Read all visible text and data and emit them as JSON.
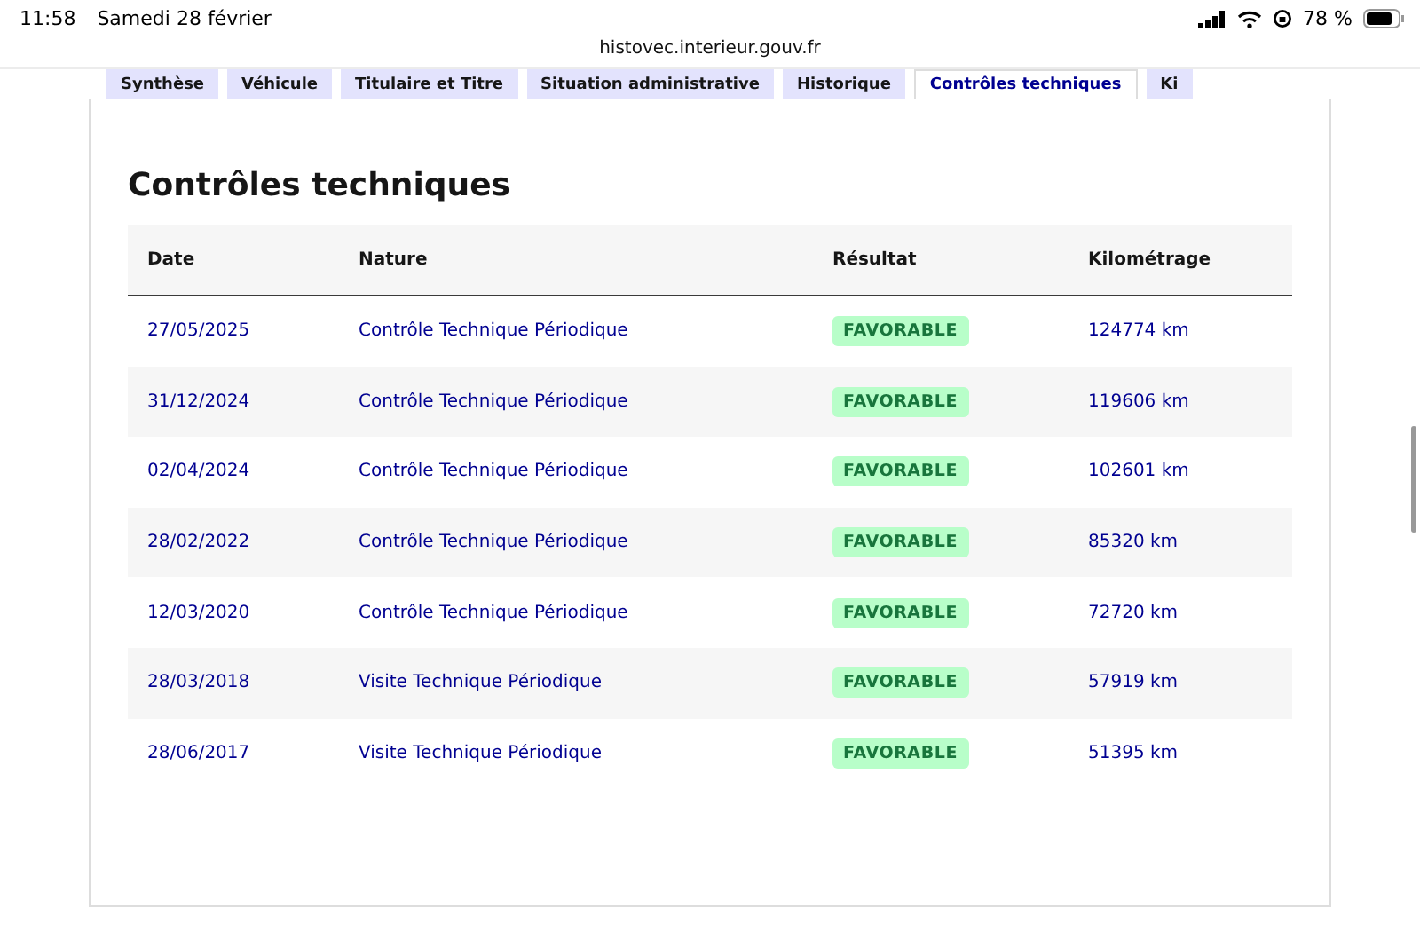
{
  "status_bar": {
    "time": "11:58",
    "date": "Samedi 28 février",
    "battery": "78 %"
  },
  "address_bar": {
    "url": "histovec.interieur.gouv.fr"
  },
  "tabs": [
    {
      "label": "Synthèse",
      "selected": false
    },
    {
      "label": "Véhicule",
      "selected": false
    },
    {
      "label": "Titulaire et Titre",
      "selected": false
    },
    {
      "label": "Situation administrative",
      "selected": false
    },
    {
      "label": "Historique",
      "selected": false
    },
    {
      "label": "Contrôles techniques",
      "selected": true
    },
    {
      "label": "Ki",
      "selected": false
    }
  ],
  "section": {
    "title": "Contrôles techniques"
  },
  "table": {
    "columns": [
      "Date",
      "Nature",
      "Résultat",
      "Kilométrage"
    ],
    "rows": [
      {
        "date": "27/05/2025",
        "nature": "Contrôle Technique Périodique",
        "result": "FAVORABLE",
        "mileage": "124774 km"
      },
      {
        "date": "31/12/2024",
        "nature": "Contrôle Technique Périodique",
        "result": "FAVORABLE",
        "mileage": "119606 km"
      },
      {
        "date": "02/04/2024",
        "nature": "Contrôle Technique Périodique",
        "result": "FAVORABLE",
        "mileage": "102601 km"
      },
      {
        "date": "28/02/2022",
        "nature": "Contrôle Technique Périodique",
        "result": "FAVORABLE",
        "mileage": "85320 km"
      },
      {
        "date": "12/03/2020",
        "nature": "Contrôle Technique Périodique",
        "result": "FAVORABLE",
        "mileage": "72720 km"
      },
      {
        "date": "28/03/2018",
        "nature": "Visite Technique Périodique",
        "result": "FAVORABLE",
        "mileage": "57919 km"
      },
      {
        "date": "28/06/2017",
        "nature": "Visite Technique Périodique",
        "result": "FAVORABLE",
        "mileage": "51395 km"
      }
    ]
  }
}
